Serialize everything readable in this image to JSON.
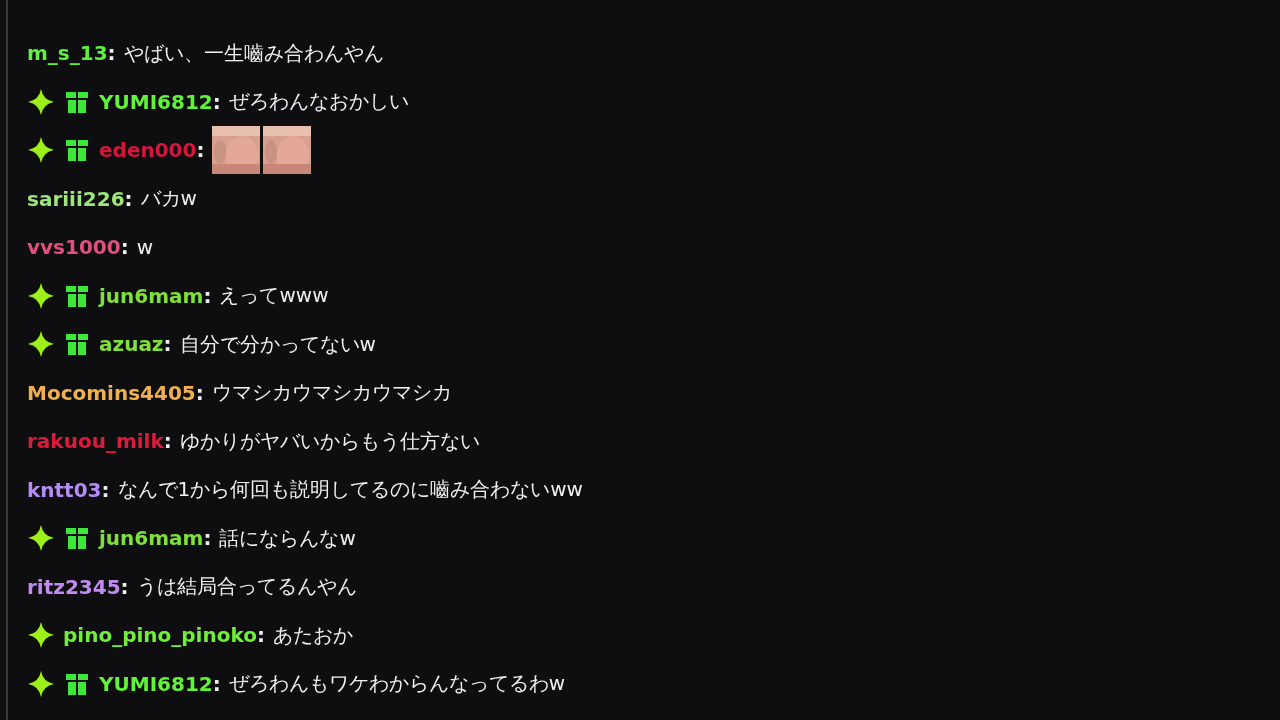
{
  "messages": [
    {
      "user": "m_s_13",
      "color": "#5ef03c",
      "separator": ":",
      "text": "やばい、一生嚙み合わんやん"
    },
    {
      "user": "YUMI6812",
      "color": "#63f23a",
      "badges": [
        {
          "kind": "sparkle"
        },
        {
          "kind": "gift"
        }
      ],
      "separator": ":",
      "text": "ぜろわんなおかしい"
    },
    {
      "user": "eden000",
      "color": "#d4153c",
      "badges": [
        {
          "kind": "sparkle"
        },
        {
          "kind": "gift"
        }
      ],
      "separator": ":"
    },
    {
      "user": "sariii226",
      "color": "#9de67a",
      "separator": ":",
      "text": "バカw"
    },
    {
      "user": "vvs1000",
      "color": "#e0507a",
      "separator": ":",
      "text": "w"
    },
    {
      "user": "jun6mam",
      "color": "#7fe03a",
      "badges": [
        {
          "kind": "sparkle"
        },
        {
          "kind": "gift"
        }
      ],
      "separator": ":",
      "text": "えってwww"
    },
    {
      "user": "azuaz",
      "color": "#7fe03a",
      "badges": [
        {
          "kind": "sparkle"
        },
        {
          "kind": "gift"
        }
      ],
      "separator": ":",
      "text": "自分で分かってないw"
    },
    {
      "user": "Mocomins4405",
      "color": "#f0b050",
      "separator": ":",
      "text": "ウマシカウマシカウマシカ"
    },
    {
      "user": "rakuou_milk",
      "color": "#dc1a3c",
      "separator": ":",
      "text": "ゆかりがヤバいからもう仕方ない"
    },
    {
      "user": "kntt03",
      "color": "#b48cf5",
      "separator": ":",
      "text": "なんで1から何回も説明してるのに嚙み合わないww"
    },
    {
      "user": "jun6mam",
      "color": "#7fe03a",
      "badges": [
        {
          "kind": "sparkle"
        },
        {
          "kind": "gift"
        }
      ],
      "separator": ":",
      "text": "話にならんなw"
    },
    {
      "user": "ritz2345",
      "color": "#c08cf0",
      "separator": ":",
      "text": "うは結局合ってるんやん"
    },
    {
      "user": "pino_pino_pinoko",
      "color": "#6ef03a",
      "badges": [
        {
          "kind": "sparkle"
        }
      ],
      "separator": ":",
      "text": "あたおか"
    },
    {
      "user": "YUMI6812",
      "color": "#63f23a",
      "badges": [
        {
          "kind": "sparkle"
        },
        {
          "kind": "gift"
        }
      ],
      "separator": ":",
      "text": "ぜろわんもワケわからんなってるわw"
    }
  ]
}
